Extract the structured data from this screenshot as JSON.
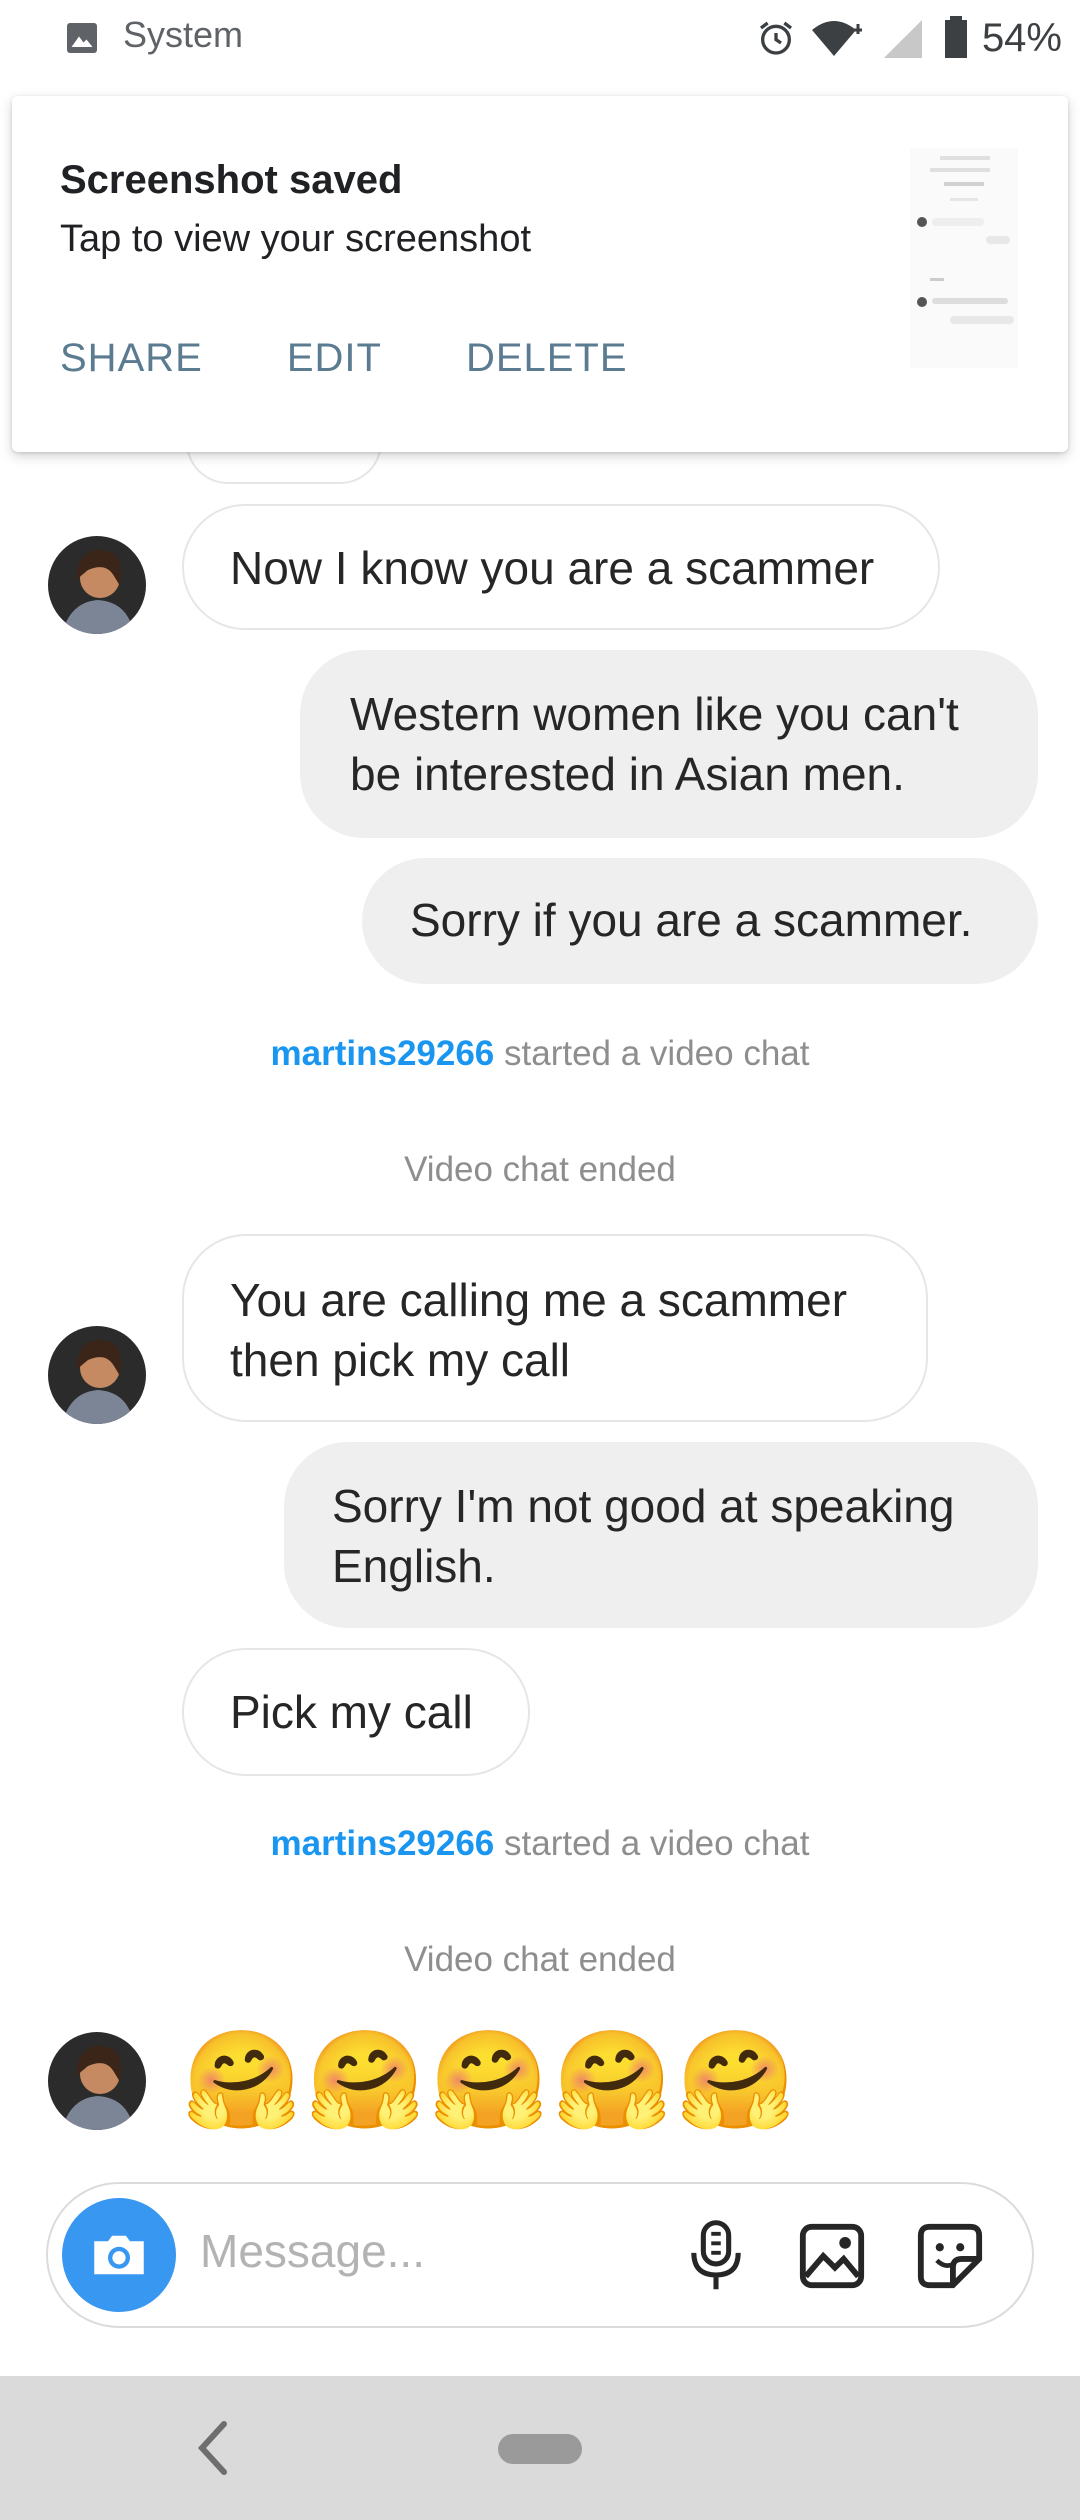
{
  "status_bar": {
    "app_name": "System",
    "battery": "54%"
  },
  "notification": {
    "title": "Screenshot saved",
    "text": "Tap to view your screenshot",
    "actions": [
      "SHARE",
      "EDIT",
      "DELETE"
    ]
  },
  "messages": [
    {
      "side": "in",
      "text": "Now I know you are a scammer"
    },
    {
      "side": "out",
      "text": "Western women like you can't be interested in Asian men."
    },
    {
      "side": "out",
      "text": "Sorry if you are a scammer."
    },
    {
      "side": "in",
      "text": "You are calling me a scammer then pick my call"
    },
    {
      "side": "out",
      "text": "Sorry I'm not good at speaking English."
    },
    {
      "side": "in",
      "text": "Pick my call"
    }
  ],
  "system_events": [
    {
      "user": "martins29266",
      "text": "started a video chat"
    },
    {
      "text": "Video chat ended"
    },
    {
      "user": "martins29266",
      "text": "started a video chat"
    },
    {
      "text": "Video chat ended"
    }
  ],
  "emoji_message": "🤗🤗🤗🤗🤗",
  "composer": {
    "placeholder": "Message..."
  },
  "colors": {
    "accent_blue": "#3897f0",
    "username_blue": "#1a96f0",
    "notification_action": "#5b7b91",
    "outgoing_bubble": "#efefef"
  },
  "icons": [
    "image-icon",
    "alarm-icon",
    "wifi-icon",
    "signal-icon",
    "battery-icon",
    "camera-icon",
    "microphone-icon",
    "gallery-icon",
    "sticker-icon",
    "back-icon",
    "home-pill-icon"
  ]
}
